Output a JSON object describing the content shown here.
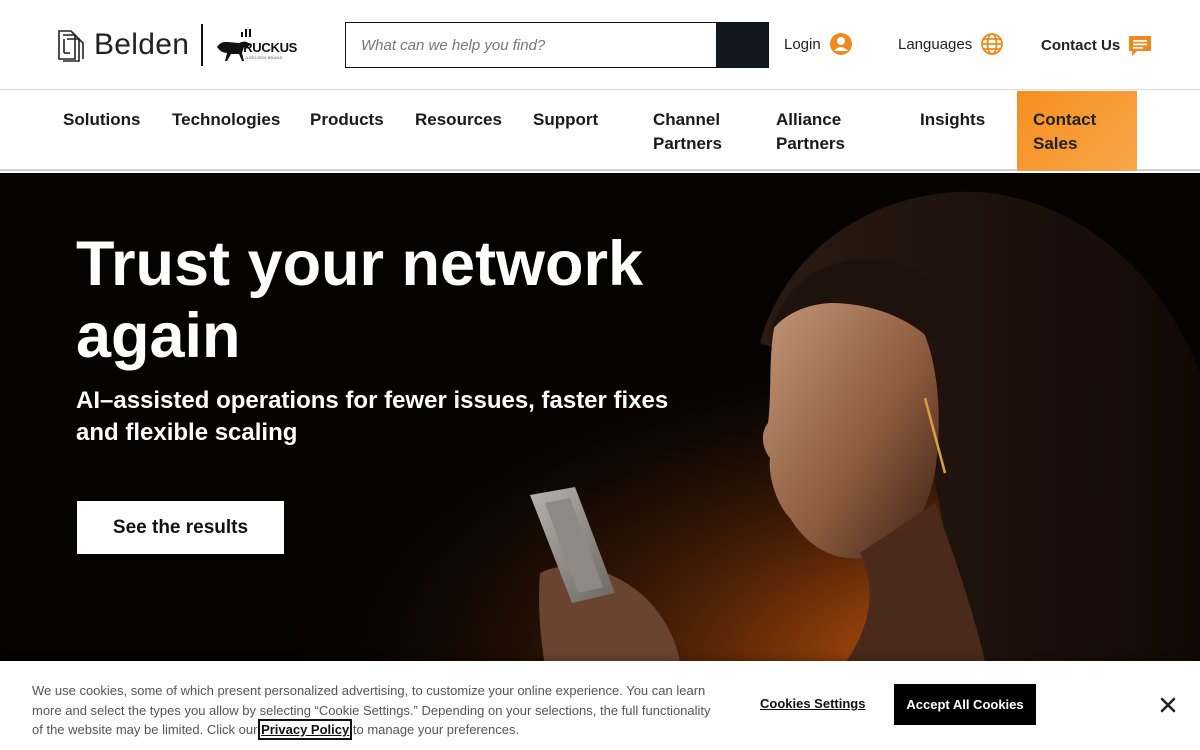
{
  "brand": {
    "name": "Belden",
    "partner_name": "RUCKUS",
    "partner_sub": "A BELDEN BRAND"
  },
  "search": {
    "placeholder": "What can we help you find?"
  },
  "utility_nav": {
    "login": "Login",
    "languages": "Languages",
    "contact": "Contact Us"
  },
  "main_nav": {
    "items": [
      {
        "label": "Solutions"
      },
      {
        "label": "Technologies"
      },
      {
        "label": "Products"
      },
      {
        "label": "Resources"
      },
      {
        "label": "Support"
      },
      {
        "label_line1": "Channel",
        "label_line2": "Partners"
      },
      {
        "label_line1": "Alliance",
        "label_line2": "Partners"
      },
      {
        "label": "Insights"
      }
    ],
    "cta_line1": "Contact",
    "cta_line2": "Sales"
  },
  "hero": {
    "title_line1": "Trust your network",
    "title_line2": "again",
    "subtitle_line1": "AI–assisted operations for fewer issues, faster fixes",
    "subtitle_line2": "and flexible scaling",
    "button_label": "See the results"
  },
  "cookie_banner": {
    "text_line1": "We use cookies, some of which present personalized advertising, to customize your online experience. You can learn",
    "text_line2": "more and select the types you allow by selecting “Cookie Settings.” Depending on your selections, the full functionality",
    "text_line3_before": "of the website may be limited. Click our",
    "privacy_link": "Privacy Policy",
    "text_line3_after": "to manage your preferences.",
    "settings_label": "Cookies Settings",
    "accept_label": "Accept All Cookies"
  },
  "colors": {
    "accent_orange": "#f58f1e",
    "icon_orange": "#f08a1c",
    "dark": "#111820",
    "hero_bg": "#050302"
  },
  "icons": {
    "login": "user-circle-icon",
    "languages": "globe-icon",
    "contact": "chat-bubble-icon",
    "search": "search-submit",
    "close": "close-icon"
  }
}
